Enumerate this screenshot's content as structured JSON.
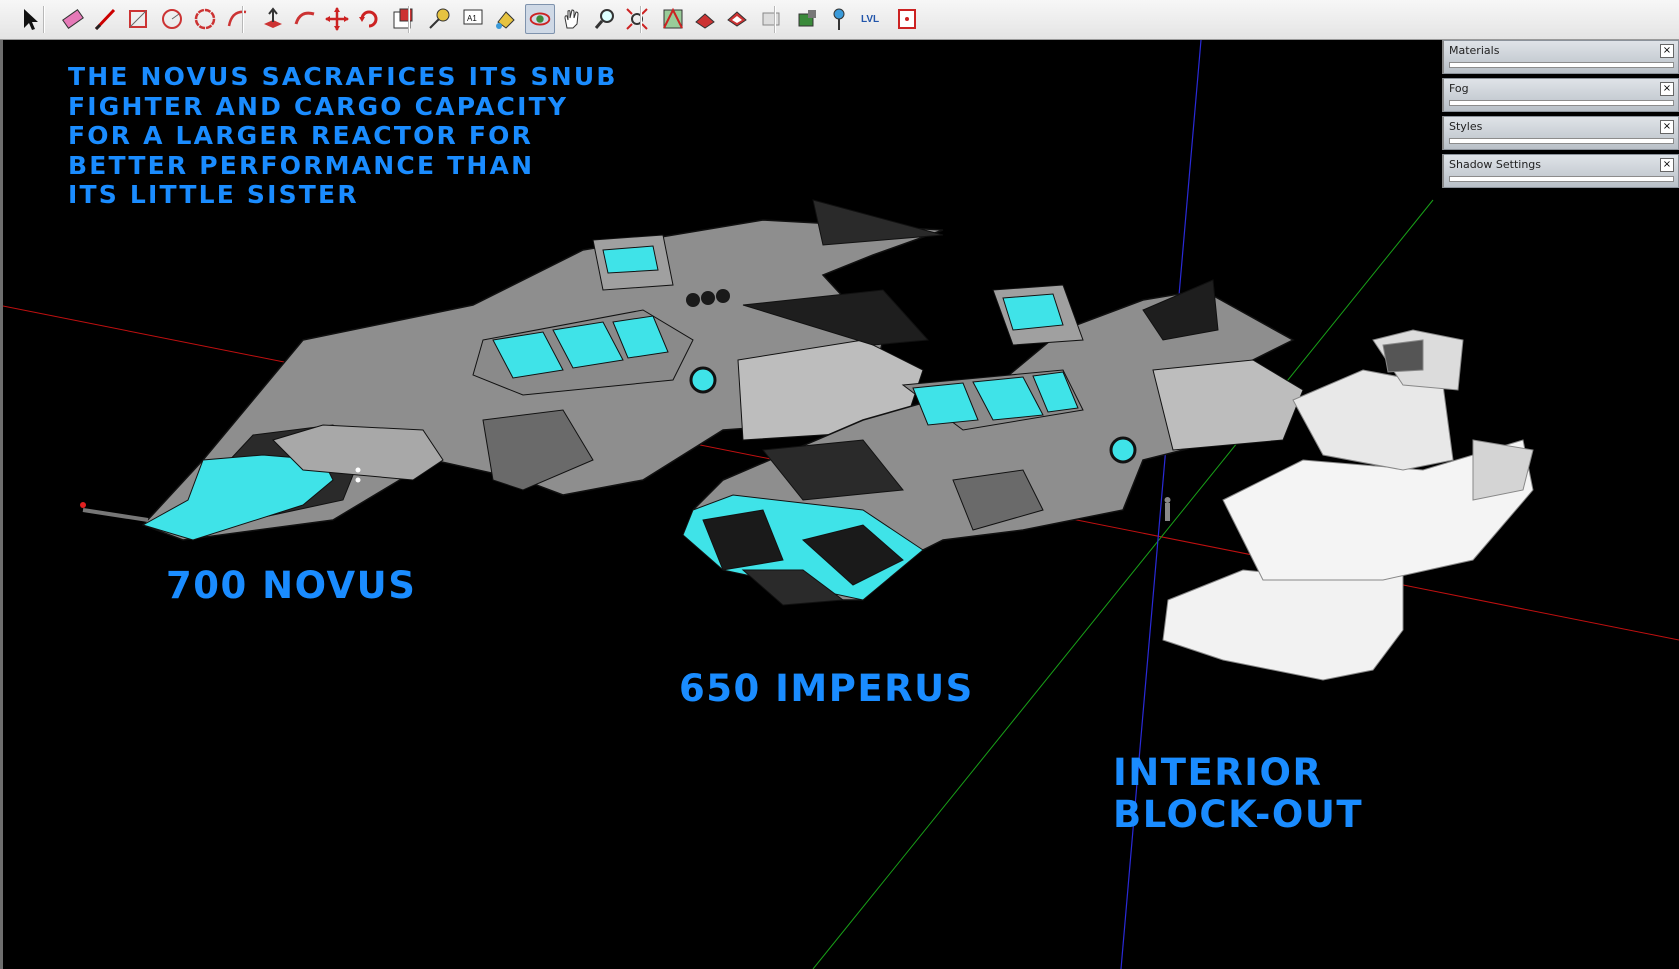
{
  "toolbar": {
    "tools": [
      {
        "name": "select-tool",
        "icon": "arrow-cursor-icon"
      },
      {
        "name": "eraser-tool",
        "icon": "eraser-icon"
      },
      {
        "name": "line-tool",
        "icon": "pencil-icon"
      },
      {
        "name": "rectangle-tool",
        "icon": "rectangle-icon"
      },
      {
        "name": "circle-tool",
        "icon": "circle-icon"
      },
      {
        "name": "polygon-tool",
        "icon": "polygon-icon"
      },
      {
        "name": "arc-tool",
        "icon": "arc-icon"
      },
      {
        "name": "push-pull-tool",
        "icon": "push-pull-icon"
      },
      {
        "name": "follow-me-tool",
        "icon": "follow-me-icon"
      },
      {
        "name": "move-tool",
        "icon": "move-arrows-icon"
      },
      {
        "name": "rotate-tool",
        "icon": "rotate-icon"
      },
      {
        "name": "scale-tool",
        "icon": "scale-icon"
      },
      {
        "name": "tape-measure-tool",
        "icon": "tape-measure-icon"
      },
      {
        "name": "text-tool",
        "icon": "text-label-icon"
      },
      {
        "name": "paint-bucket-tool",
        "icon": "paint-bucket-icon"
      },
      {
        "name": "orbit-tool",
        "icon": "orbit-icon"
      },
      {
        "name": "pan-tool",
        "icon": "hand-icon"
      },
      {
        "name": "zoom-tool",
        "icon": "magnifier-icon"
      },
      {
        "name": "zoom-extents-tool",
        "icon": "zoom-extents-icon"
      },
      {
        "name": "get-models-tool",
        "icon": "warehouse-icon"
      },
      {
        "name": "share-model-tool",
        "icon": "share-model-icon"
      },
      {
        "name": "share-component-tool",
        "icon": "share-component-icon"
      },
      {
        "name": "extension-warehouse-tool",
        "icon": "extension-icon"
      },
      {
        "name": "add-location-tool",
        "icon": "location-icon"
      },
      {
        "name": "photo-texture-tool",
        "icon": "map-pin-icon"
      },
      {
        "name": "lvl-plugin-tool",
        "icon": "lvl-icon"
      },
      {
        "name": "section-plane-tool",
        "icon": "section-box-icon"
      }
    ],
    "lvl_text": "LVL",
    "text_tool_text": "A1",
    "active_tool": "orbit-tool"
  },
  "overlay": {
    "caption": "The Novus sacrafices its snub\nfighter and cargo capacity\nfor a larger reactor for\nbetter performance than\nits little sister",
    "label_novus": "700 Novus",
    "label_imperus": "650 Imperus",
    "label_interior": "Interior\nBlock-out",
    "text_color": "#1a8cff"
  },
  "trays": [
    {
      "title": "Materials"
    },
    {
      "title": "Fog"
    },
    {
      "title": "Styles"
    },
    {
      "title": "Shadow Settings"
    }
  ],
  "tray_close_glyph": "×",
  "colors": {
    "background": "#000000",
    "hull_grey": "#8f8f8f",
    "hull_dark": "#2a2a2a",
    "glow_cyan": "#3fe3e8",
    "block_white": "#f2f2f2",
    "axis_red": "#d01010",
    "axis_green": "#10b010",
    "axis_blue": "#2020d0"
  }
}
